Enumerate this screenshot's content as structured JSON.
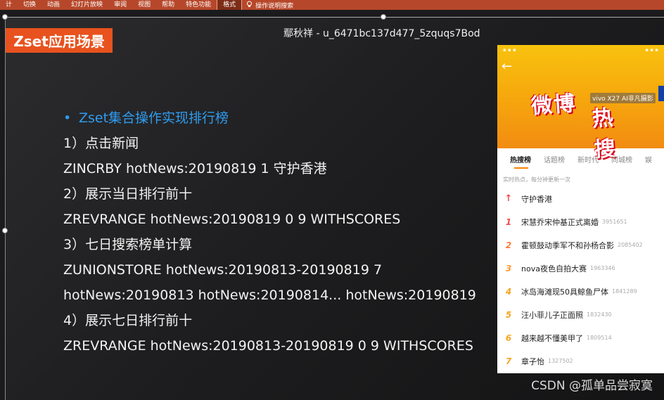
{
  "ribbon": {
    "tabs": [
      "计",
      "切换",
      "动画",
      "幻灯片放映",
      "审阅",
      "视图",
      "帮助",
      "特色功能",
      "格式"
    ],
    "active_tab": "格式",
    "tell_me": "操作说明搜索",
    "bulb_icon": "lightbulb-icon"
  },
  "slide": {
    "title": "Zset应用场景",
    "watermark": "鄢秋祥 - u_6471bc137d477_5zquqs7Bod",
    "bullet_heading": "Zset集合操作实现排行榜",
    "lines": [
      "1）点击新闻",
      "ZINCRBY  hotNews:20190819  1  守护香港",
      "2）展示当日排行前十",
      "ZREVRANGE  hotNews:20190819  0  9  WITHSCORES",
      "3）七日搜索榜单计算",
      "ZUNIONSTORE  hotNews:20190813-20190819  7",
      "hotNews:20190813  hotNews:20190814... hotNews:20190819",
      "4）展示七日排行前十",
      "ZREVRANGE hotNews:20190813-20190819  0  9  WITHSCORES"
    ]
  },
  "phone": {
    "logo_line1": "微博",
    "logo_line2": "热搜",
    "vivo": "vivo X27 AI非凡摄影",
    "tabs": [
      "热搜榜",
      "话题榜",
      "新时代",
      "同城榜",
      "娱"
    ],
    "active_tab": "热搜榜",
    "subtitle": "实时热点，每分钟更新一次",
    "items": [
      {
        "rank": "↑",
        "title": "守护香港",
        "heat": ""
      },
      {
        "rank": "1",
        "title": "宋慧乔宋仲基正式离婚",
        "heat": "3951651"
      },
      {
        "rank": "2",
        "title": "霍顿鼓动季军不和孙杨合影",
        "heat": "2085402"
      },
      {
        "rank": "3",
        "title": "nova夜色自拍大赛",
        "heat": "1963346"
      },
      {
        "rank": "4",
        "title": "冰岛海滩现50具鲸鱼尸体",
        "heat": "1841289"
      },
      {
        "rank": "5",
        "title": "汪小菲儿子正面照",
        "heat": "1832430"
      },
      {
        "rank": "6",
        "title": "越来越不懂美甲了",
        "heat": "1809514"
      },
      {
        "rank": "7",
        "title": "章子怡",
        "heat": "1327502"
      }
    ]
  },
  "footer": {
    "csdn": "CSDN @孤单品尝寂寞"
  },
  "colors": {
    "ribbon": "#b7472a",
    "title_box": "#e8521e",
    "bullet": "#2f9cf0"
  }
}
